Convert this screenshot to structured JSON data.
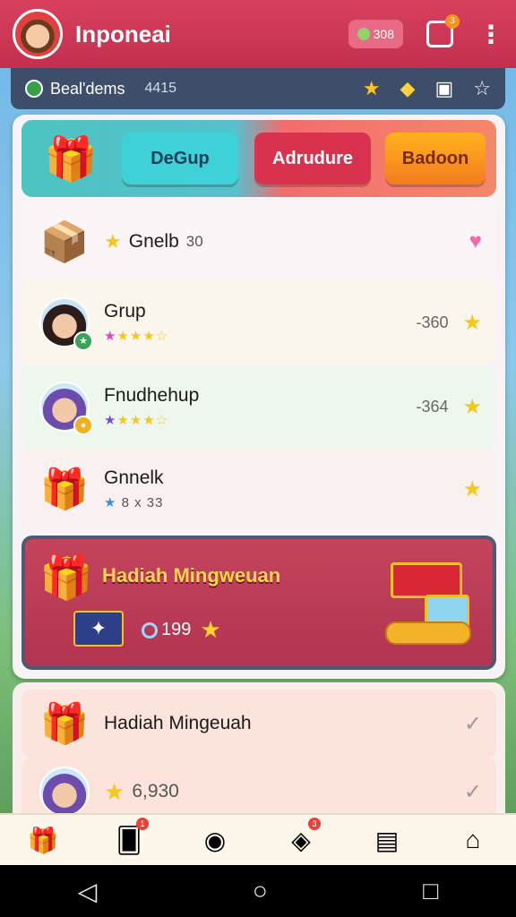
{
  "header": {
    "title": "Inponeai",
    "coins": "308",
    "notif_badge": "3",
    "more_icon": "⋮"
  },
  "status": {
    "label": "Beal'dems",
    "count": "4415"
  },
  "tabs": {
    "items": [
      "DeGup",
      "Adrudure",
      "Badoon"
    ]
  },
  "rows": [
    {
      "title": "Gnelb",
      "sub": "30",
      "end": "♥"
    },
    {
      "title": "Grup",
      "value": "-360",
      "end": "★"
    },
    {
      "title": "Fnudhehup",
      "value": "-364",
      "end": "★"
    },
    {
      "title": "Gnnelk",
      "meta": "8 x 33",
      "end": "★"
    }
  ],
  "weekly": {
    "title": "Hadiah Mingweuan",
    "points": "199"
  },
  "panel2": {
    "rows": [
      {
        "title": "Hadiah Mingeuah"
      },
      {
        "title": "6,930"
      }
    ]
  },
  "bottom_nav": {
    "items": [
      {
        "icon": "gift-icon",
        "badge": ""
      },
      {
        "icon": "card-icon",
        "badge": "1"
      },
      {
        "icon": "coin-icon",
        "badge": ""
      },
      {
        "icon": "gem-icon",
        "badge": "3"
      },
      {
        "icon": "chest-icon",
        "badge": ""
      },
      {
        "icon": "home-icon",
        "badge": ""
      }
    ]
  },
  "colors": {
    "brand": "#c2304f",
    "accent": "#f2c81d",
    "status_bg": "#3e4d6a"
  }
}
